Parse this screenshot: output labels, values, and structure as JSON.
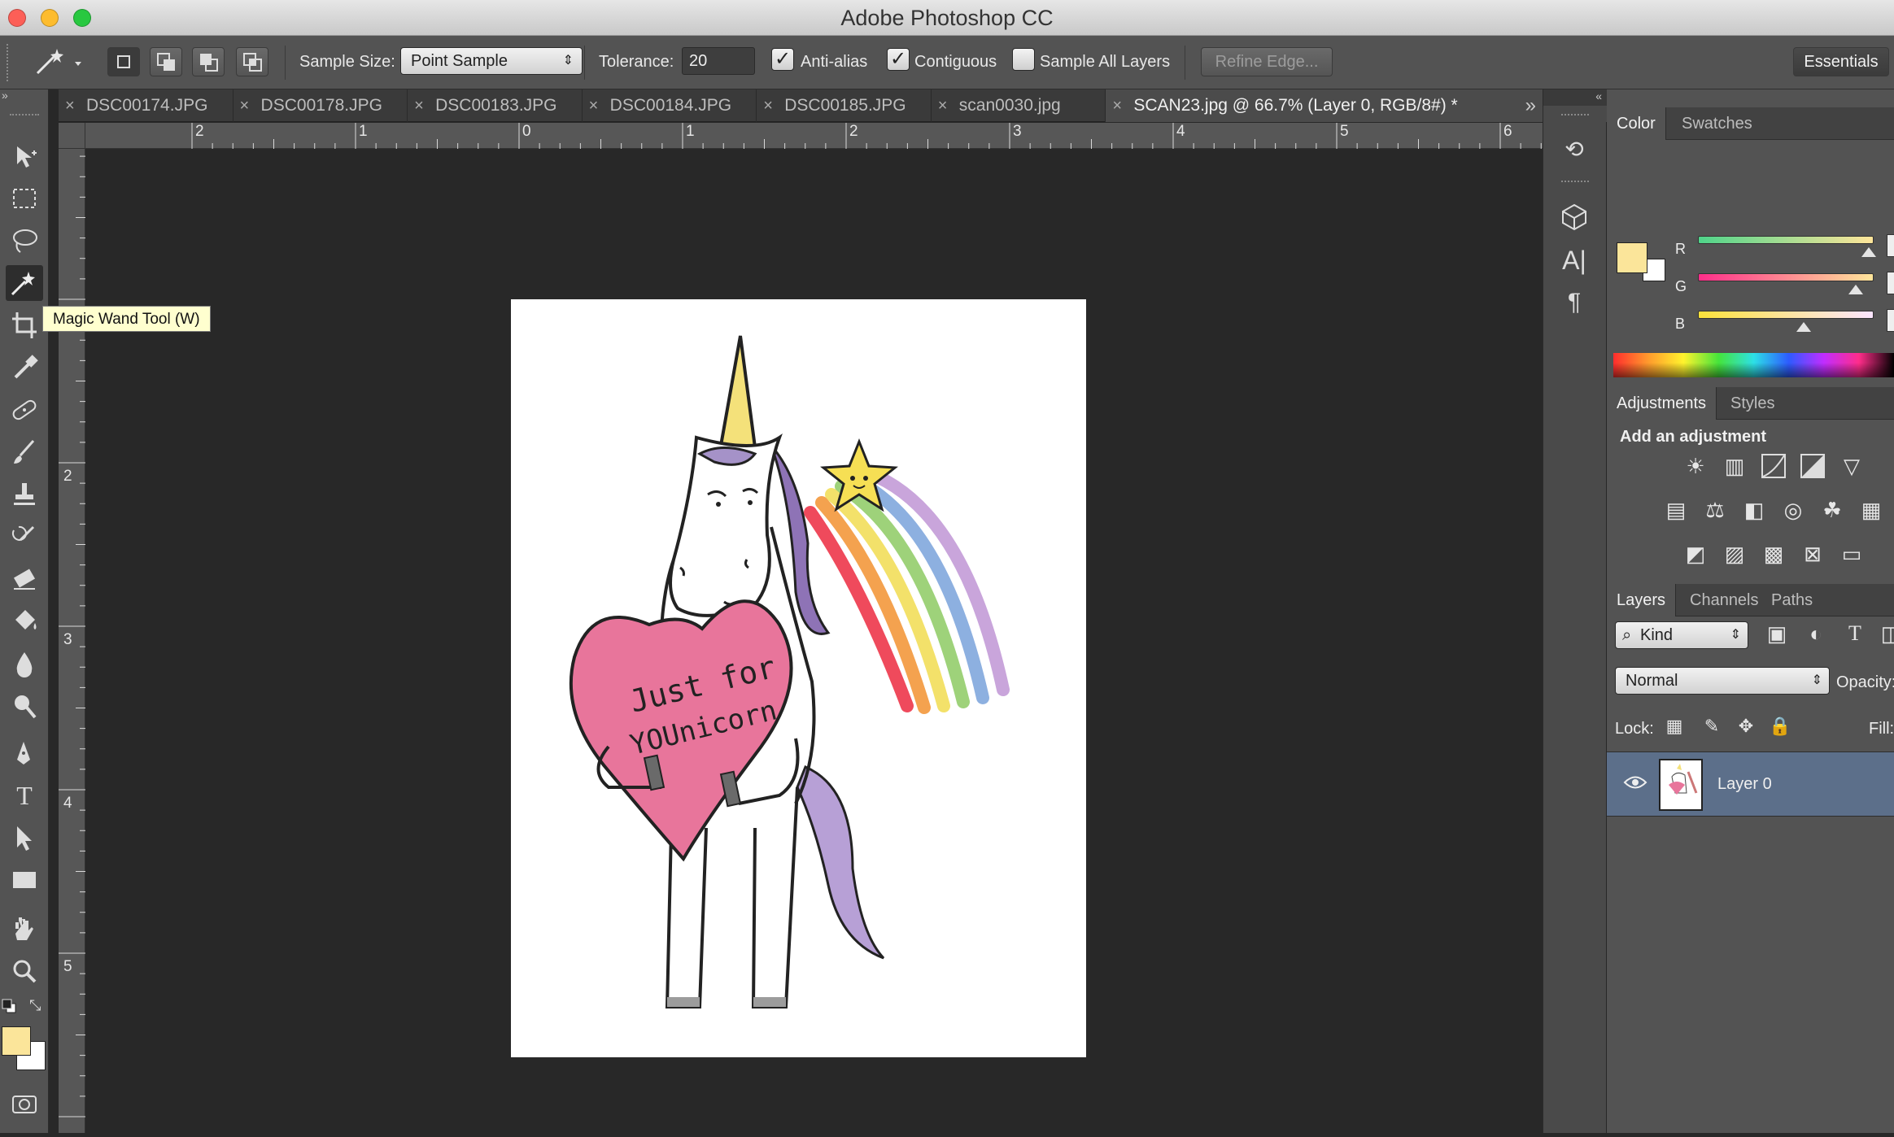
{
  "window": {
    "title": "Adobe Photoshop CC",
    "traffic_colors": {
      "close": "#fc5f57",
      "minimize": "#fdbc2e",
      "zoom": "#28c840"
    }
  },
  "options_bar": {
    "sample_size_label": "Sample Size:",
    "sample_size_value": "Point Sample",
    "tolerance_label": "Tolerance:",
    "tolerance_value": "20",
    "anti_alias_label": "Anti-alias",
    "anti_alias_checked": true,
    "contiguous_label": "Contiguous",
    "contiguous_checked": true,
    "sample_all_layers_label": "Sample All Layers",
    "sample_all_layers_checked": false,
    "refine_edge_label": "Refine Edge...",
    "workspace_label": "Essentials",
    "check_glyph": "✓"
  },
  "tabs": [
    {
      "label": "DSC00174.JPG",
      "active": false
    },
    {
      "label": "DSC00178.JPG",
      "active": false
    },
    {
      "label": "DSC00183.JPG",
      "active": false
    },
    {
      "label": "DSC00184.JPG",
      "active": false
    },
    {
      "label": "DSC00185.JPG",
      "active": false
    },
    {
      "label": "scan0030.jpg",
      "active": false
    },
    {
      "label": "SCAN23.jpg @ 66.7% (Layer 0, RGB/8#) *",
      "active": true
    }
  ],
  "tab_close_glyph": "×",
  "tabs_overflow_glyph": "»",
  "ruler": {
    "top_labels": [
      "2",
      "1",
      "0",
      "1",
      "2",
      "3",
      "4",
      "5",
      "6"
    ],
    "left_labels": [
      "1",
      "2",
      "3",
      "4",
      "5"
    ]
  },
  "tooltip": "Magic Wand Tool (W)",
  "artwork": {
    "heart_text_line1": "Just for",
    "heart_text_line2": "YOUnicorn"
  },
  "colors": {
    "foreground": "#fbe59a",
    "background": "#ffffff",
    "layer_selected": "#5c6f8a"
  },
  "color_panel": {
    "tabs": [
      "Color",
      "Swatches"
    ],
    "channels": [
      {
        "name": "R",
        "level": 0.97
      },
      {
        "name": "G",
        "level": 0.9
      },
      {
        "name": "B",
        "level": 0.6
      }
    ]
  },
  "adjustments_panel": {
    "tabs": [
      "Adjustments",
      "Styles"
    ],
    "heading": "Add an adjustment"
  },
  "layers_panel": {
    "tabs": [
      "Layers",
      "Channels",
      "Paths"
    ],
    "filter_label": "Kind",
    "blend_mode": "Normal",
    "opacity_label": "Opacity:",
    "lock_label": "Lock:",
    "fill_label": "Fill:",
    "layers": [
      {
        "name": "Layer 0",
        "visible": true
      }
    ]
  }
}
